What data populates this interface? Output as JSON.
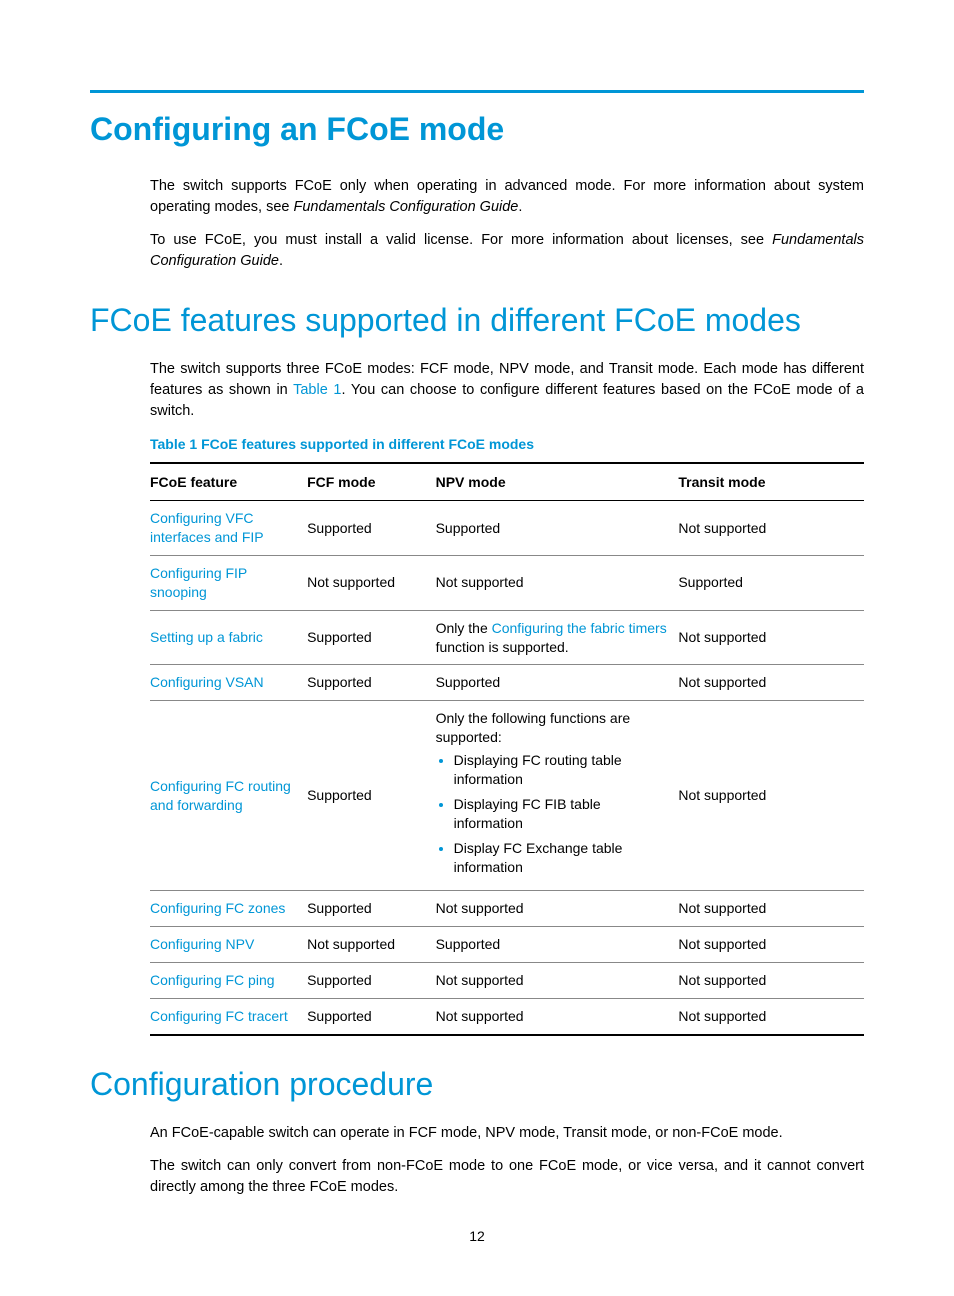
{
  "title": "Configuring an FCoE mode",
  "intro": {
    "p1a": "The switch supports FCoE only when operating in advanced mode. For more information about system operating modes, see ",
    "p1b": "Fundamentals Configuration Guide",
    "p1c": ".",
    "p2a": "To use FCoE, you must install a valid license. For more information about licenses, see ",
    "p2b": "Fundamentals Configuration Guide",
    "p2c": "."
  },
  "section2_title": "FCoE features supported in different FCoE modes",
  "section2_body": {
    "p1a": "The switch supports three FCoE modes: FCF mode, NPV mode, and Transit mode. Each mode has different features as shown in ",
    "p1_link": "Table 1",
    "p1b": ". You can choose to configure different features based on the FCoE mode of a switch."
  },
  "table_caption": "Table 1 FCoE features supported in different FCoE modes",
  "table": {
    "headers": [
      "FCoE feature",
      "FCF mode",
      "NPV mode",
      "Transit mode"
    ],
    "rows": [
      {
        "feature": "Configuring VFC interfaces and FIP",
        "fcf": "Supported",
        "npv": "Supported",
        "transit": "Not supported"
      },
      {
        "feature": "Configuring FIP snooping",
        "fcf": "Not supported",
        "npv": "Not supported",
        "transit": "Supported"
      },
      {
        "feature": "Setting up a fabric",
        "fcf": "Supported",
        "npv_pre": "Only the ",
        "npv_link": "Configuring the fabric timers",
        "npv_post": " function is supported.",
        "transit": "Not supported"
      },
      {
        "feature": "Configuring VSAN",
        "fcf": "Supported",
        "npv": "Supported",
        "transit": "Not supported"
      },
      {
        "feature": "Configuring FC routing and forwarding",
        "fcf": "Supported",
        "npv_intro": "Only the following functions are supported:",
        "npv_list": [
          "Displaying FC routing table information",
          "Displaying FC FIB table information",
          "Display FC Exchange table information"
        ],
        "transit": "Not supported"
      },
      {
        "feature": "Configuring FC zones",
        "fcf": "Supported",
        "npv": "Not supported",
        "transit": "Not supported"
      },
      {
        "feature": "Configuring NPV",
        "fcf": "Not supported",
        "npv": "Supported",
        "transit": "Not supported"
      },
      {
        "feature": "Configuring FC ping",
        "fcf": "Supported",
        "npv": "Not supported",
        "transit": "Not supported"
      },
      {
        "feature": "Configuring FC tracert",
        "fcf": "Supported",
        "npv": "Not supported",
        "transit": "Not supported"
      }
    ]
  },
  "section3_title": "Configuration procedure",
  "section3_body": {
    "p1": "An FCoE-capable switch can operate in FCF mode, NPV mode, Transit mode, or non-FCoE mode.",
    "p2": "The switch can only convert from non-FCoE mode to one FCoE mode, or vice versa, and it cannot convert directly among the three FCoE modes."
  },
  "page_number": "12"
}
